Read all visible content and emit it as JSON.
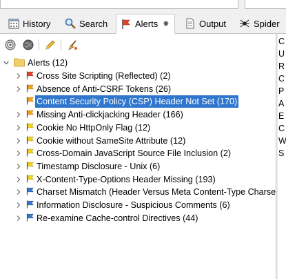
{
  "tabs": [
    {
      "label": "History",
      "icon": "history-icon"
    },
    {
      "label": "Search",
      "icon": "search-icon"
    },
    {
      "label": "Alerts",
      "icon": "alerts-flag-icon",
      "active": true,
      "pinned": true
    },
    {
      "label": "Output",
      "icon": "output-icon"
    },
    {
      "label": "Spider",
      "icon": "spider-icon"
    }
  ],
  "toolbar": {
    "buttons": [
      "scan-target-icon",
      "globe-icon",
      "edit-pencil-icon",
      "clear-broom-icon"
    ]
  },
  "tree": {
    "root_label": "Alerts (12)",
    "items": [
      {
        "label": "Cross Site Scripting (Reflected) (2)",
        "risk": "high",
        "flag_color": "#e0462b"
      },
      {
        "label": "Absence of Anti-CSRF Tokens (26)",
        "risk": "medium",
        "flag_color": "#f0a21a"
      },
      {
        "label": "Content Security Policy (CSP) Header Not Set (170)",
        "risk": "medium",
        "flag_color": "#f0a21a",
        "selected": true
      },
      {
        "label": "Missing Anti-clickjacking Header (166)",
        "risk": "medium",
        "flag_color": "#f0a21a"
      },
      {
        "label": "Cookie No HttpOnly Flag (12)",
        "risk": "low",
        "flag_color": "#f2d21c"
      },
      {
        "label": "Cookie without SameSite Attribute (12)",
        "risk": "low",
        "flag_color": "#f2d21c"
      },
      {
        "label": "Cross-Domain JavaScript Source File Inclusion (2)",
        "risk": "low",
        "flag_color": "#f2d21c"
      },
      {
        "label": "Timestamp Disclosure - Unix (6)",
        "risk": "low",
        "flag_color": "#f2d21c"
      },
      {
        "label": "X-Content-Type-Options Header Missing (193)",
        "risk": "low",
        "flag_color": "#f2d21c"
      },
      {
        "label": "Charset Mismatch (Header Versus Meta Content-Type Charset)",
        "risk": "info",
        "flag_color": "#3a78c9"
      },
      {
        "label": "Information Disclosure - Suspicious Comments (6)",
        "risk": "info",
        "flag_color": "#3a78c9"
      },
      {
        "label": "Re-examine Cache-control Directives (44)",
        "risk": "info",
        "flag_color": "#3a78c9"
      }
    ]
  },
  "right_panel": {
    "letters": [
      "C",
      "U",
      "R",
      "C",
      "P",
      "A",
      "E",
      "C",
      "W",
      "S"
    ]
  },
  "colors": {
    "selection": "#2f76cf",
    "folder": "#f3cf6a"
  }
}
